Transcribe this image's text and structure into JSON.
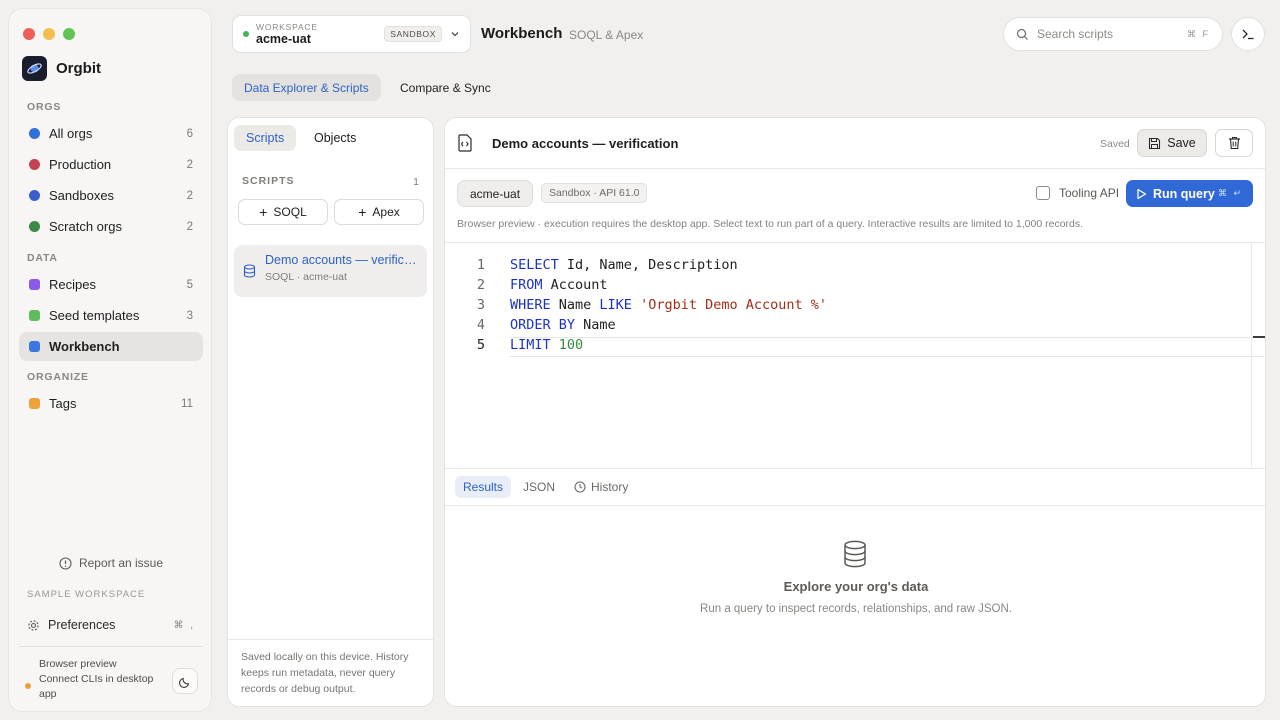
{
  "window": {
    "traffic_colors": [
      "#ee5f57",
      "#f4bd4f",
      "#5fc454"
    ]
  },
  "brand": {
    "name": "Orgbit"
  },
  "sidebar": {
    "sections": {
      "orgs": "ORGS",
      "data": "DATA",
      "organize": "ORGANIZE"
    },
    "items": [
      {
        "label": "All orgs",
        "count": "6",
        "color": "#3070d9"
      },
      {
        "label": "Production",
        "count": "2",
        "color": "#c2424f"
      },
      {
        "label": "Sandboxes",
        "count": "2",
        "color": "#3a5fcd"
      },
      {
        "label": "Scratch orgs",
        "count": "2",
        "color": "#3c8a47"
      },
      {
        "label": "Recipes",
        "count": "5",
        "color": "#8b5ae6"
      },
      {
        "label": "Seed templates",
        "count": "3",
        "color": "#5ebd5a"
      },
      {
        "label": "Workbench",
        "count": "",
        "color": "#3a78e0"
      },
      {
        "label": "Tags",
        "count": "11",
        "color": "#efa23a"
      }
    ],
    "report_issue": "Report an issue",
    "sample_workspace": "SAMPLE WORKSPACE",
    "preferences": "Preferences",
    "preferences_kbd": "⌘ ,",
    "browser_preview_title": "Browser preview",
    "browser_preview_text": "Connect CLIs in desktop app"
  },
  "workspace": {
    "kicker": "WORKSPACE",
    "name": "acme-uat",
    "badge": "SANDBOX"
  },
  "header": {
    "title": "Workbench",
    "subtitle": "SOQL & Apex"
  },
  "search": {
    "placeholder": "Search scripts",
    "kbd": "⌘ F"
  },
  "top_tabs": [
    "Data Explorer & Scripts",
    "Compare & Sync"
  ],
  "scripts_panel": {
    "tabs": [
      "Scripts",
      "Objects"
    ],
    "heading": "SCRIPTS",
    "count": "1",
    "new_soql": "SOQL",
    "new_apex": "Apex",
    "items": [
      {
        "name": "Demo accounts — verification",
        "meta": "SOQL · acme-uat"
      }
    ],
    "footer": "Saved locally on this device. History keeps run metadata, never query records or debug output."
  },
  "editor": {
    "title": "Demo accounts — verification",
    "saved_status": "Saved",
    "save_label": "Save",
    "org_chip": "acme-uat",
    "api_chip": "Sandbox · API 61.0",
    "tooling_label": "Tooling API",
    "run_label": "Run query",
    "run_kbd": "⌘ ↵",
    "hint": "Browser preview · execution requires the desktop app. Select text to run part of a query. Interactive results are limited to 1,000 records.",
    "code": [
      {
        "n": "1",
        "kw": "SELECT",
        "rest": " Id, Name, Description"
      },
      {
        "n": "2",
        "kw": "FROM",
        "rest": " Account"
      },
      {
        "n": "3",
        "kw": "WHERE",
        "rest": " Name ",
        "kw2": "LIKE",
        "str": " 'Orgbit Demo Account %'"
      },
      {
        "n": "4",
        "kw": "ORDER BY",
        "rest": " Name"
      },
      {
        "n": "5",
        "kw": "LIMIT",
        "num": " 100"
      }
    ]
  },
  "results": {
    "tabs": [
      "Results",
      "JSON",
      "History"
    ],
    "empty_title": "Explore your org's data",
    "empty_sub": "Run a query to inspect records, relationships, and raw JSON."
  }
}
